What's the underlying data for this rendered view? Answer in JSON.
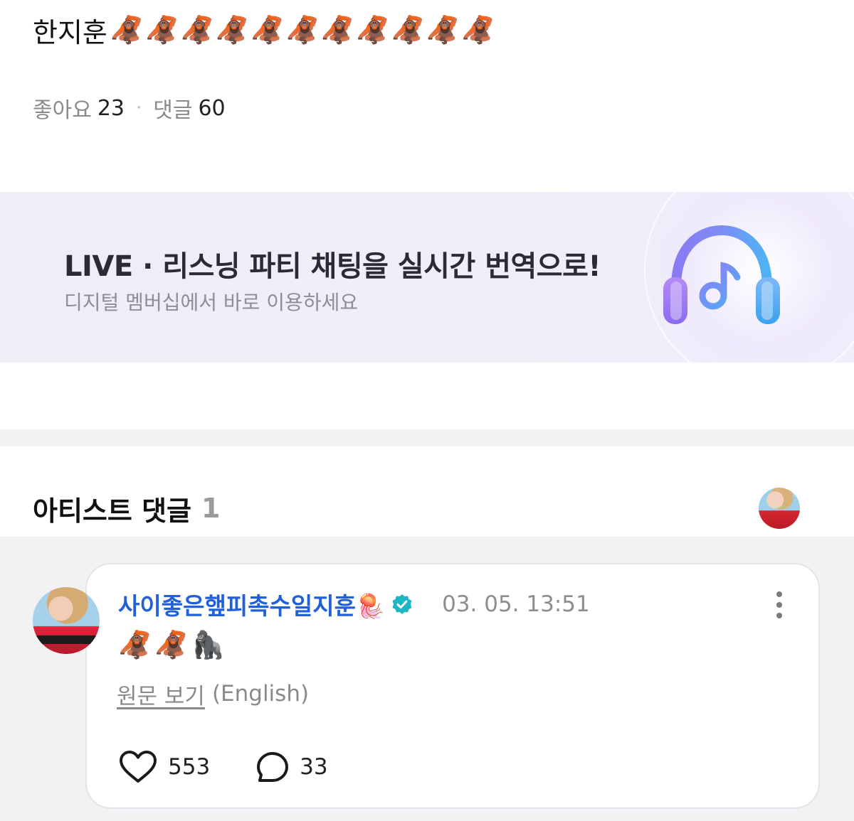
{
  "post": {
    "title_text": "한지훈",
    "title_emojis": [
      "🦧",
      "🦧",
      "🦧",
      "🦧",
      "🦧",
      "🦧",
      "🦧",
      "🦧",
      "🦧",
      "🦧",
      "🦧"
    ],
    "likes_label": "좋아요",
    "likes_count": "23",
    "comments_label": "댓글",
    "comments_count": "60",
    "separator": "·"
  },
  "banner": {
    "title": "LIVE · 리스닝 파티 채팅을 실시간 번역으로!",
    "subtitle": "디지털 멤버십에서 바로 이용하세요",
    "icon": "headphones-music-icon"
  },
  "artist_comments": {
    "title": "아티스트 댓글",
    "count": "1"
  },
  "comment": {
    "author": "사이좋은햎피촉수일지훈🪼",
    "timestamp": "03. 05. 13:51",
    "emojis": [
      "🦧",
      "🦧",
      "🦍"
    ],
    "view_original": "원문 보기",
    "original_language": "(English)",
    "like_count": "553",
    "reply_count": "33",
    "icons": {
      "like": "heart-outline-icon",
      "reply": "speech-bubble-icon",
      "verified": "verified-badge-icon",
      "more": "more-vertical-icon"
    }
  },
  "colors": {
    "author_name": "#2160d9",
    "verified_badge": "#1fb6c4",
    "muted_text": "#8a8a8a"
  }
}
